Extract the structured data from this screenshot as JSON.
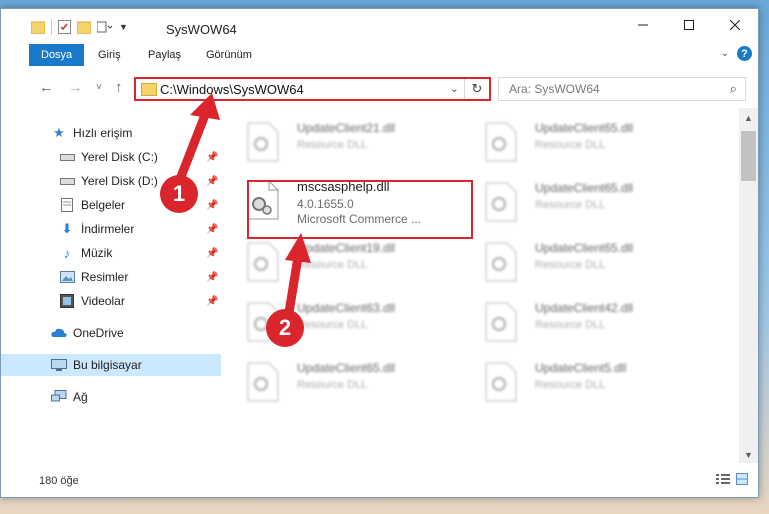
{
  "window": {
    "title": "SysWOW64",
    "controls": [
      "minimize",
      "maximize",
      "close"
    ]
  },
  "ribbon": {
    "tabs": [
      "Dosya",
      "Giriş",
      "Paylaş",
      "Görünüm"
    ],
    "active": "Dosya",
    "help": "?"
  },
  "navigation": {
    "back": "←",
    "forward": "→",
    "recent": "˅",
    "up": "↑",
    "address": "C:\\Windows\\SysWOW64",
    "search_placeholder": "Ara: SysWOW64"
  },
  "sidebar": {
    "items": [
      {
        "label": "Hızlı erişim",
        "icon": "star-icon"
      },
      {
        "label": "Yerel Disk (C:)",
        "icon": "drive-icon",
        "pinned": true
      },
      {
        "label": "Yerel Disk (D:)",
        "icon": "drive-icon",
        "pinned": true
      },
      {
        "label": "Belgeler",
        "icon": "documents-icon",
        "pinned": true
      },
      {
        "label": "İndirmeler",
        "icon": "download-icon",
        "pinned": true
      },
      {
        "label": "Müzik",
        "icon": "music-icon",
        "pinned": true
      },
      {
        "label": "Resimler",
        "icon": "pictures-icon",
        "pinned": true
      },
      {
        "label": "Videolar",
        "icon": "video-icon",
        "pinned": true
      },
      {
        "label": "OneDrive",
        "icon": "cloud-icon"
      },
      {
        "label": "Bu bilgisayar",
        "icon": "computer-icon",
        "selected": true
      },
      {
        "label": "Ağ",
        "icon": "network-icon"
      }
    ]
  },
  "files": {
    "highlighted": {
      "name": "mscsasphelp.dll",
      "version": "4.0.1655.0",
      "description": "Microsoft Commerce ..."
    },
    "left_column": [
      {
        "name": "UpdateClient21.dll",
        "desc": "Resource DLL"
      },
      {
        "name": "UpdateClient19.dll",
        "desc": "Resource DLL"
      },
      {
        "name": "UpdateClient63.dll",
        "desc": "Resource DLL"
      },
      {
        "name": "UpdateClient65.dll",
        "desc": "Resource DLL"
      }
    ],
    "right_column": [
      {
        "name": "UpdateClient65.dll",
        "desc": "Resource DLL"
      },
      {
        "name": "UpdateClient65.dll",
        "desc": "Resource DLL"
      },
      {
        "name": "UpdateClient65.dll",
        "desc": "Resource DLL"
      },
      {
        "name": "UpdateClient42.dll",
        "desc": "Resource DLL"
      },
      {
        "name": "UpdateClient5.dll",
        "desc": "Resource DLL"
      }
    ]
  },
  "status": {
    "count": "180 öğe"
  },
  "annotations": {
    "step1": "1",
    "step2": "2",
    "color": "#d9252b"
  }
}
